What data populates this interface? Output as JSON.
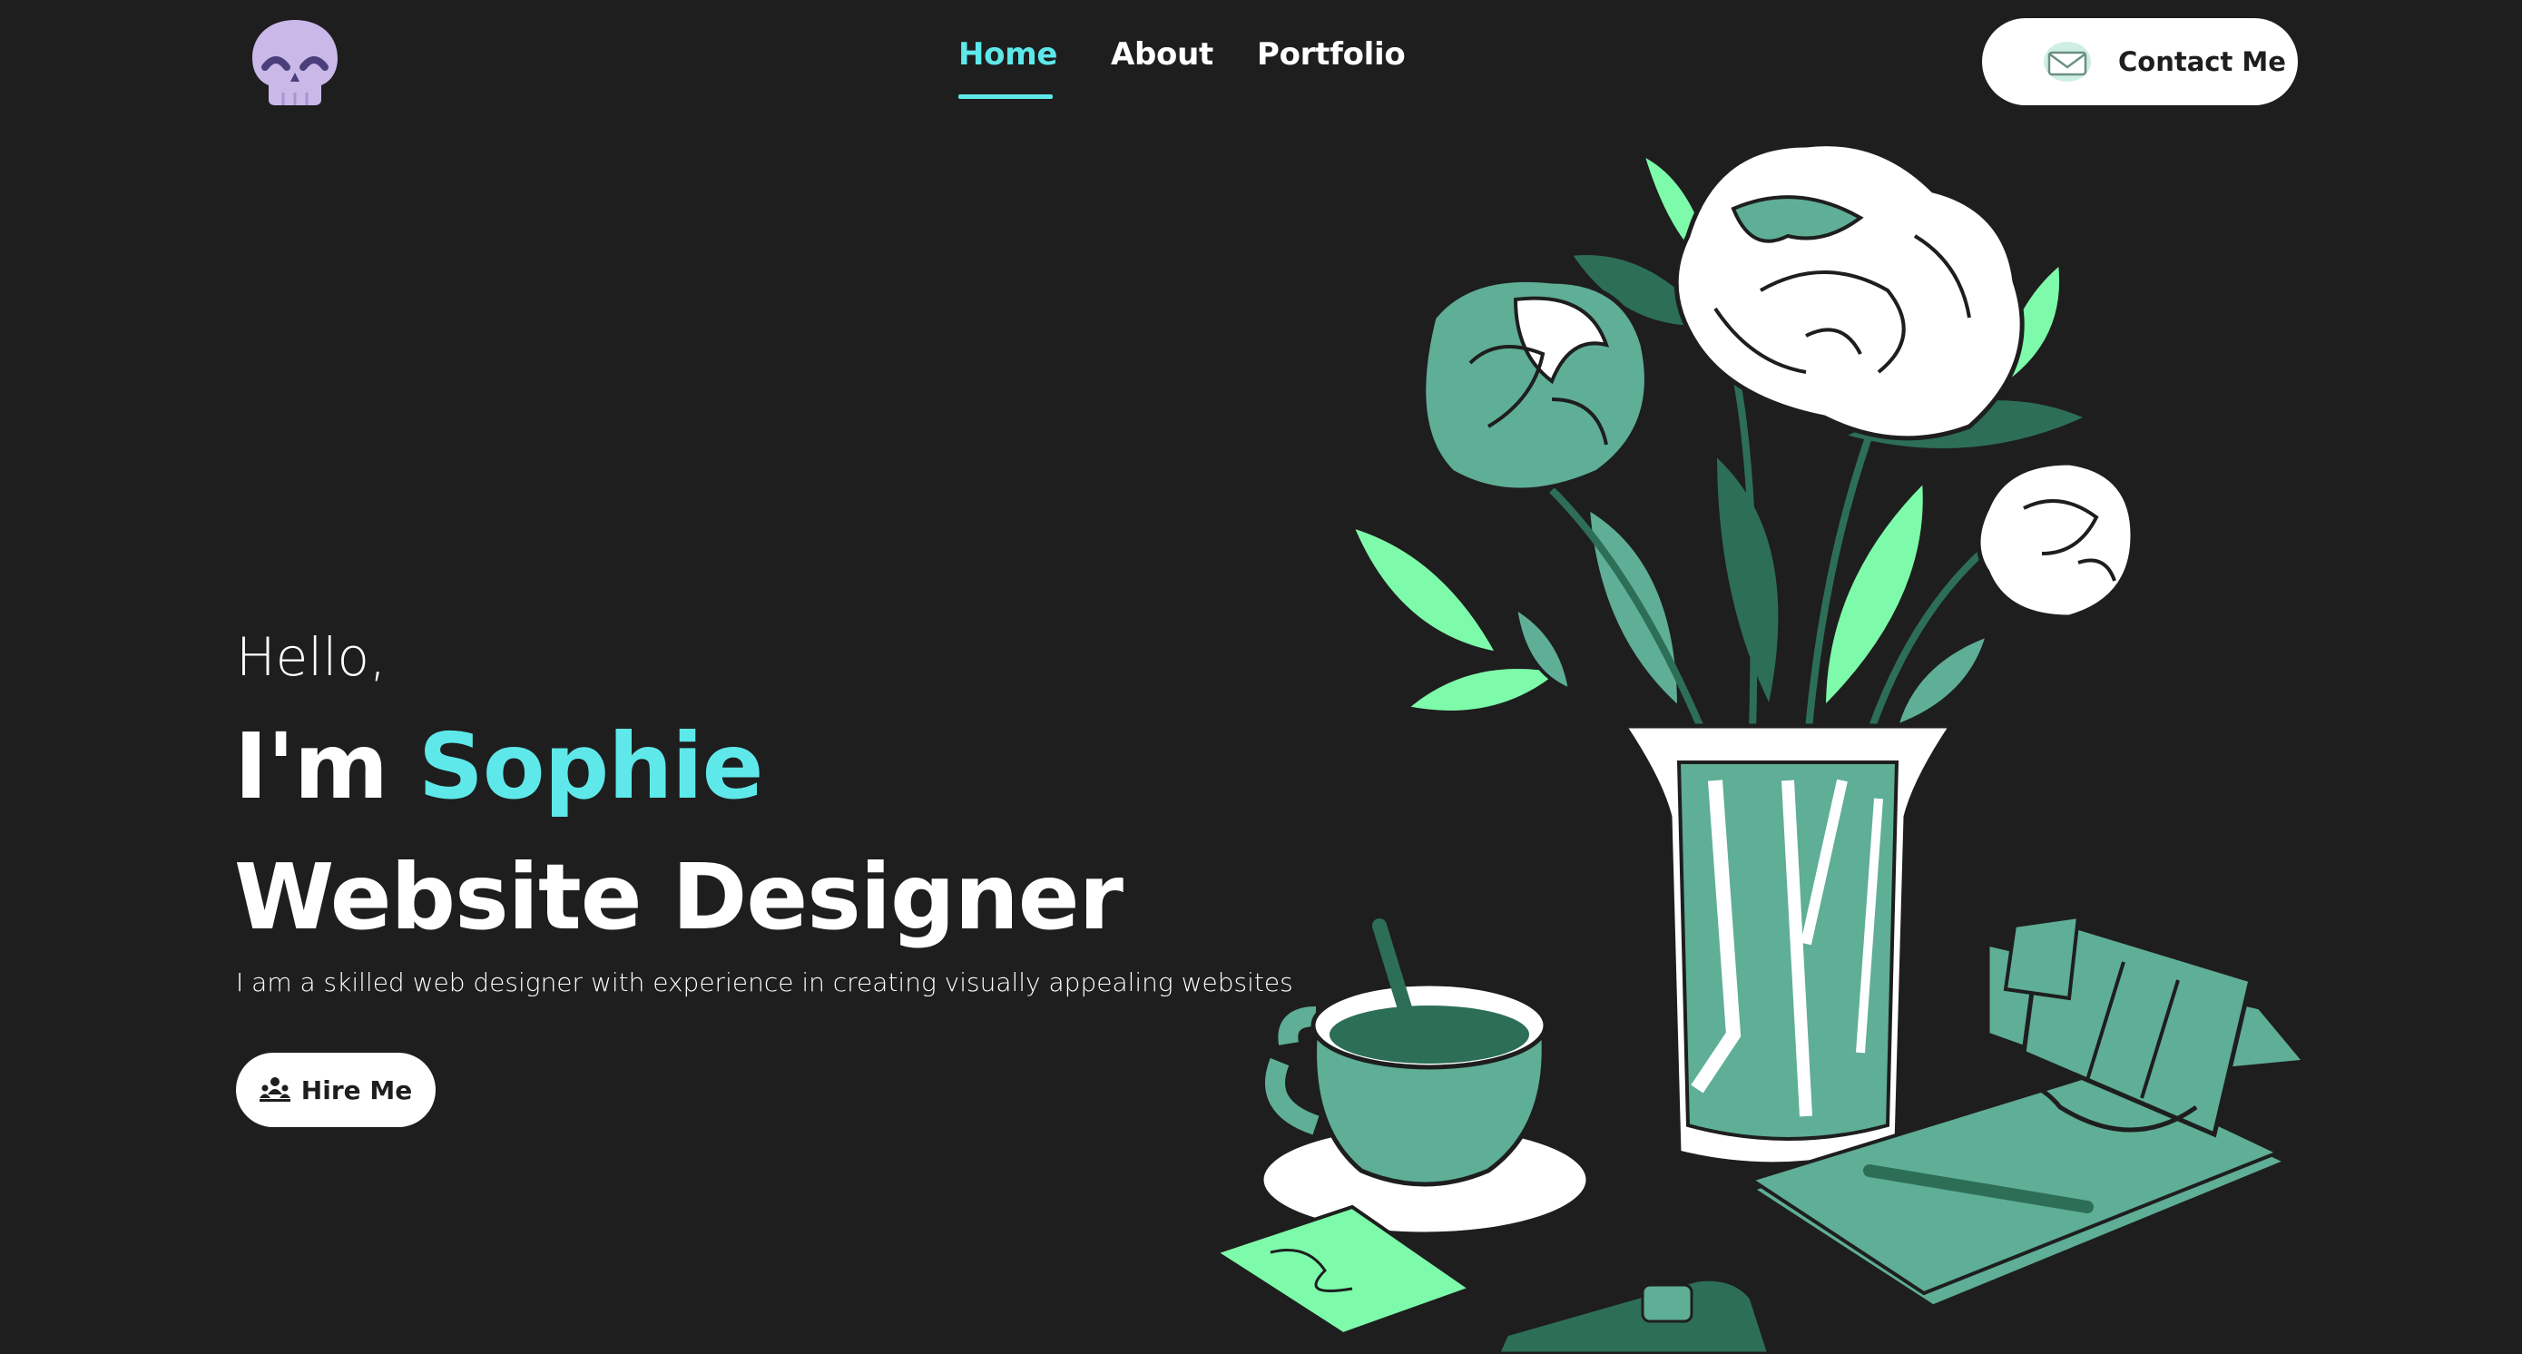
{
  "header": {
    "nav": [
      {
        "label": "Home",
        "active": true
      },
      {
        "label": "About",
        "active": false
      },
      {
        "label": "Portfolio",
        "active": false
      }
    ],
    "contact_label": "Contact Me",
    "logo_icon": "skull-icon",
    "contact_icon": "envelope-icon"
  },
  "hero": {
    "greeting": "Hello,",
    "im_prefix": "I'm ",
    "name": "Sophie",
    "role": "Website Designer",
    "description": "I am a skilled web designer with experience in creating visually appealing websites",
    "hire_label": "Hire Me",
    "hire_icon": "team-icon"
  },
  "colors": {
    "background": "#1e1e1e",
    "accent": "#5ee8ea",
    "illustration_green": "#5fae96",
    "illustration_dark_green": "#2d6e57",
    "illustration_light_green": "#7dfbaa",
    "logo_purple": "#c9b8e8"
  }
}
